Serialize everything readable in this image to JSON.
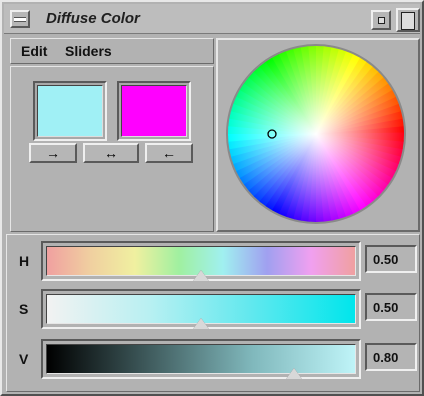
{
  "window": {
    "title": "Diffuse Color"
  },
  "menu": {
    "items": [
      "Edit",
      "Sliders"
    ]
  },
  "swatches": {
    "current_color": "#a0f0f5",
    "previous_color": "#ff00ff"
  },
  "buttons": {
    "copy_right": "→",
    "swap": "↔",
    "copy_left": "←"
  },
  "wheel": {
    "hue": 0.5,
    "saturation": 0.5,
    "value": 0.8
  },
  "sliders": [
    {
      "label": "H",
      "value": "0.50",
      "position": 0.5
    },
    {
      "label": "S",
      "value": "0.50",
      "position": 0.5
    },
    {
      "label": "V",
      "value": "0.80",
      "position": 0.8
    }
  ]
}
